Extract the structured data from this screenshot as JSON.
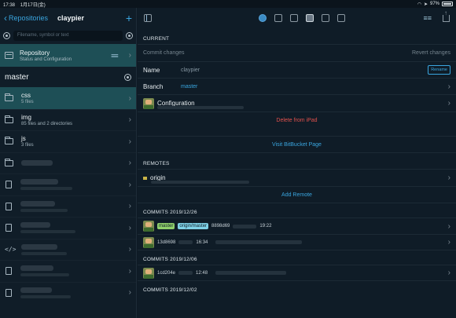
{
  "status_bar": {
    "time": "17:38",
    "date": "1月17日(金)",
    "battery": "97%"
  },
  "sidebar": {
    "back_label": "Repositories",
    "title": "claypier",
    "add_label": "+",
    "search_placeholder": "Filename, symbol or text",
    "repository": {
      "title": "Repository",
      "subtitle": "Status and Configuration"
    },
    "branch": "master",
    "files": [
      {
        "name": "css",
        "detail": "5 files",
        "icon": "folder-icon",
        "selected": true
      },
      {
        "name": "img",
        "detail": "85 files and 2 directories",
        "icon": "folder-icon",
        "selected": false
      },
      {
        "name": "js",
        "detail": "3 files",
        "icon": "folder-icon",
        "selected": false
      }
    ]
  },
  "toolbar": {
    "icons": [
      "sidebar-icon",
      "globe-icon",
      "message-icon",
      "image-icon",
      "info-icon",
      "terminal-icon",
      "alert-icon",
      "filter-icon",
      "share-icon"
    ]
  },
  "current": {
    "section_label": "CURRENT",
    "commit_changes": "Commit changes",
    "revert_changes": "Revert changes",
    "name_label": "Name",
    "name_value": "claypier",
    "rename_label": "Rename",
    "branch_label": "Branch",
    "branch_value": "master",
    "configuration_label": "Configuration",
    "delete_label": "Delete from iPad",
    "visit_label": "Visit BitBucket Page"
  },
  "remotes": {
    "section_label": "REMOTES",
    "origin_label": "origin",
    "add_label": "Add Remote"
  },
  "commits": [
    {
      "header": "COMMITS 2019/12/26",
      "rows": [
        {
          "tags": [
            "master",
            "origin/master"
          ],
          "hash": "8898d69",
          "time": "19:22"
        },
        {
          "tags": [],
          "hash": "13d8698",
          "time": "16:34"
        }
      ]
    },
    {
      "header": "COMMITS 2019/12/06",
      "rows": [
        {
          "tags": [],
          "hash": "1cd204e",
          "time": "12:48"
        }
      ]
    },
    {
      "header": "COMMITS 2019/12/02",
      "rows": []
    }
  ],
  "colors": {
    "accent": "#3aa6e0",
    "danger": "#e2514d",
    "selected_row": "#1e4f56",
    "background": "#0f1c27"
  }
}
